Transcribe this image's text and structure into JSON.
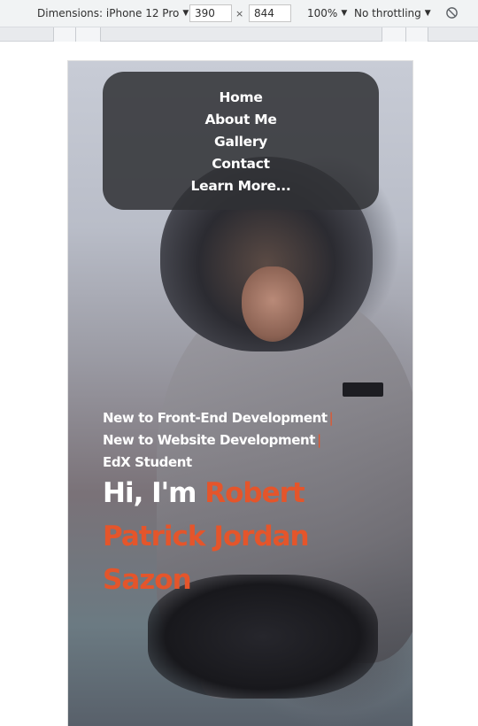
{
  "devtools": {
    "dimensions_label": "Dimensions: iPhone 12 Pro",
    "width": "390",
    "times": "×",
    "height": "844",
    "zoom": "100%",
    "throttling": "No throttling",
    "caret": "▼"
  },
  "nav": {
    "items": [
      {
        "label": "Home"
      },
      {
        "label": "About Me"
      },
      {
        "label": "Gallery"
      },
      {
        "label": "Contact"
      },
      {
        "label": "Learn More..."
      }
    ]
  },
  "hero": {
    "taglines": [
      {
        "text": "New to Front-End Development"
      },
      {
        "text": "New to Website Development"
      },
      {
        "text": "EdX Student"
      }
    ],
    "cursor": "|",
    "greeting": "Hi, I'm ",
    "name": "Robert Patrick Jordan Sazon"
  },
  "colors": {
    "accent": "#e4552b",
    "nav_bg": "#303134",
    "text": "#ffffff"
  }
}
